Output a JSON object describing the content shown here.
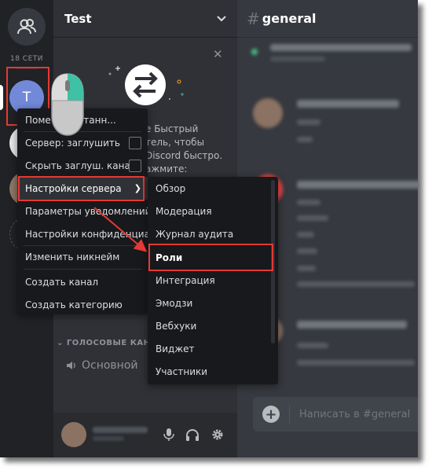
{
  "rail": {
    "online_count": "18 СЕТИ",
    "selected_server_initial": "T"
  },
  "sidebar": {
    "server_name": "Test",
    "invite_text_lines": [
      "е Быстрый",
      "тель, чтобы",
      "Discord быстро.",
      "ажмите:"
    ],
    "voice_category": "ГОЛОСОВЫЕ КАНА",
    "voice_channel": "Основной"
  },
  "chat": {
    "channel_name": "general",
    "input_placeholder": "Написать в #general"
  },
  "context_menu": {
    "items": [
      {
        "label": "Поме     прочитанн..."
      },
      {
        "label": "Сервер: заглушить",
        "checkbox": false
      },
      {
        "label": "Скрыть заглуш. кана...",
        "checkbox": false
      },
      {
        "label": "Настройки сервера",
        "submenu": true
      },
      {
        "label": "Параметры уведомлений"
      },
      {
        "label": "Настройки конфиденциа..."
      },
      {
        "label": "Изменить никнейм"
      },
      {
        "label": "Создать канал"
      },
      {
        "label": "Создать категорию"
      }
    ]
  },
  "submenu": {
    "items": [
      {
        "label": "Обзор"
      },
      {
        "label": "Модерация"
      },
      {
        "label": "Журнал аудита"
      },
      {
        "label": "Роли"
      },
      {
        "label": "Интеграция"
      },
      {
        "label": "Эмодзи"
      },
      {
        "label": "Вебхуки"
      },
      {
        "label": "Виджет"
      },
      {
        "label": "Участники"
      }
    ]
  },
  "colors": {
    "annotation_red": "#e53935",
    "blurple": "#7289da",
    "mouse_highlight": "#3ec1a4"
  },
  "icons": [
    "people-icon",
    "close-icon",
    "chevron-down-icon",
    "invite-arrows-icon",
    "speaker-icon",
    "microphone-icon",
    "headphones-icon",
    "gear-icon",
    "hash-icon",
    "plus-icon",
    "mouse-icon",
    "chevron-right-icon"
  ]
}
